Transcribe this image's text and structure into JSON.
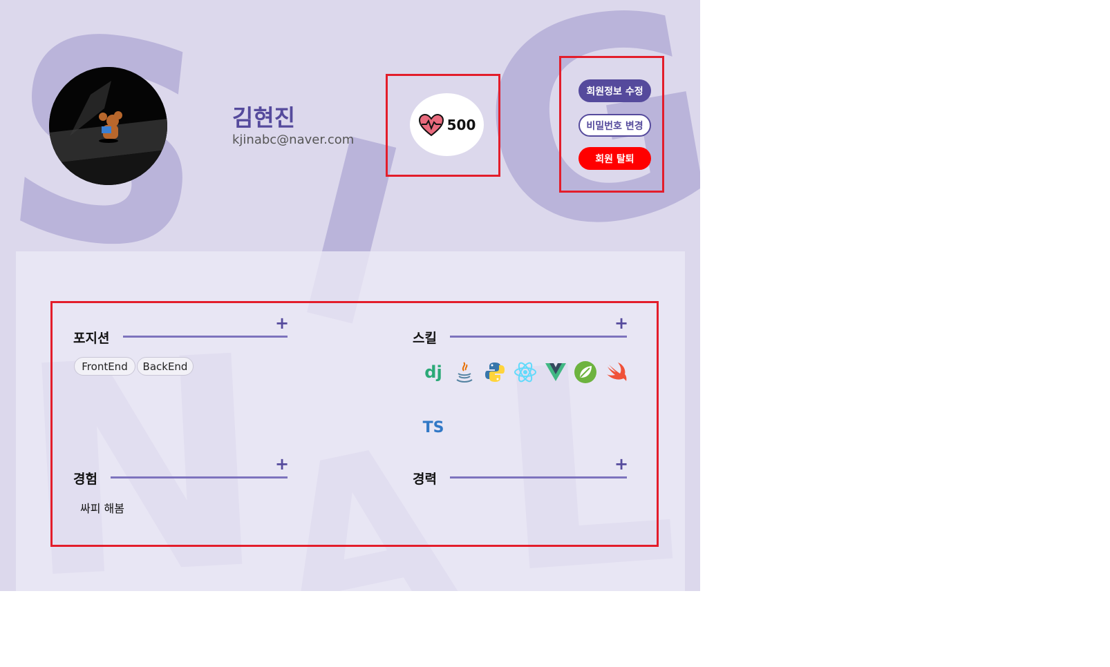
{
  "profile": {
    "name": "김현진",
    "email": "kjinabc@naver.com",
    "avatar_icon": "mouse-character-avatar"
  },
  "points": {
    "icon": "heart-pulse-icon",
    "value": "500"
  },
  "actions": {
    "edit_profile": "회원정보 수정",
    "change_password": "비밀번호 변경",
    "withdraw": "회원 탈퇴"
  },
  "sections": {
    "position": {
      "title": "포지션",
      "add_icon": "plus-icon",
      "chips": [
        "FrontEnd",
        "BackEnd"
      ]
    },
    "skill": {
      "title": "스킬",
      "add_icon": "plus-icon",
      "icons": [
        "django-icon",
        "java-icon",
        "python-icon",
        "react-icon",
        "vue-icon",
        "spring-icon",
        "swift-icon",
        "typescript-icon"
      ],
      "labels": {
        "django": "dj",
        "typescript": "TS"
      }
    },
    "experience": {
      "title": "경험",
      "add_icon": "plus-icon",
      "items": [
        "싸피 해봄"
      ]
    },
    "career": {
      "title": "경력",
      "add_icon": "plus-icon",
      "items": []
    }
  },
  "colors": {
    "page_bg": "#dcd8ec",
    "brand": "#554a9c",
    "danger": "#ff0000",
    "highlight_box": "#e31d2b"
  }
}
